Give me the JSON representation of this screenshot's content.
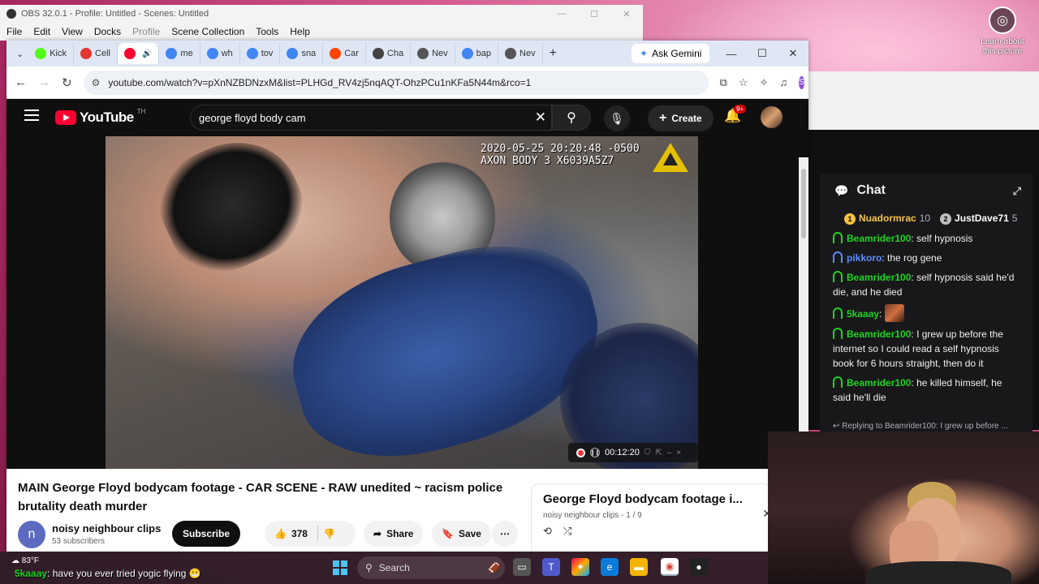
{
  "desktop": {
    "lens_label_line1": "Learn about",
    "lens_label_line2": "this picture"
  },
  "obs": {
    "title": "OBS 32.0.1 - Profile: Untitled - Scenes: Untitled",
    "menu": [
      "File",
      "Edit",
      "View",
      "Docks",
      "Profile",
      "Scene Collection",
      "Tools",
      "Help"
    ]
  },
  "chrome": {
    "tabs": [
      {
        "label": "Kick",
        "icon": "kick-icon",
        "color": "#53fc18"
      },
      {
        "label": "Cell",
        "icon": "cell-icon",
        "color": "#e5352f"
      },
      {
        "label": "",
        "icon": "youtube-icon",
        "color": "#ff0033"
      },
      {
        "label": "me",
        "icon": "google-icon",
        "color": "#4285f4"
      },
      {
        "label": "wh",
        "icon": "google-icon",
        "color": "#4285f4"
      },
      {
        "label": "tov",
        "icon": "google-icon",
        "color": "#4285f4"
      },
      {
        "label": "sna",
        "icon": "google-icon",
        "color": "#4285f4"
      },
      {
        "label": "Car",
        "icon": "reddit-icon",
        "color": "#ff4500"
      },
      {
        "label": "Cha",
        "icon": "chatgpt-icon",
        "color": "#444444"
      },
      {
        "label": "Nev",
        "icon": "chrome-icon",
        "color": "#555555"
      },
      {
        "label": "bap",
        "icon": "google-icon",
        "color": "#4285f4"
      },
      {
        "label": "Nev",
        "icon": "chrome-icon",
        "color": "#555555"
      }
    ],
    "ask_gemini": "Ask Gemini",
    "url": "youtube.com/watch?v=pXnNZBDNzxM&list=PLHGd_RV4zj5nqAQT-OhzPCu1nKFa5N44m&rco=1",
    "profile_initial": "S"
  },
  "youtube": {
    "logo": "YouTube",
    "country": "TH",
    "search_value": "george floyd body cam",
    "create_label": "Create",
    "notif_count": "9+",
    "video": {
      "stamp_line1": "2020-05-25 20:20:48 -0500",
      "stamp_line2": "AXON BODY 3 X6039A5Z7",
      "rec_time": "00:12:20"
    },
    "title": "MAIN George Floyd bodycam footage - CAR SCENE - RAW unedited ~ racism police brutality death murder",
    "channel": {
      "initial": "n",
      "name": "noisy neighbour clips",
      "subs": "53 subscribers",
      "subscribe": "Subscribe"
    },
    "likes": "378",
    "share": "Share",
    "save": "Save",
    "playlist": {
      "title": "George Floyd bodycam footage i...",
      "meta": "noisy neighbour clips - 1 / 9"
    }
  },
  "chat": {
    "title": "Chat",
    "leaders": [
      {
        "rank": "1",
        "name": "Nuadormrac",
        "points": "10",
        "color": "#f5c242",
        "name_color": "#f5c242"
      },
      {
        "rank": "2",
        "name": "JustDave71",
        "points": "5",
        "color": "#c0c0c0",
        "name_color": "#ffffff"
      }
    ],
    "messages": [
      {
        "user": "Beamrider100",
        "text": "self hypnosis",
        "color": "#1fd51f"
      },
      {
        "user": "pikkoro",
        "text": "the rog gene",
        "color": "#5b8cff"
      },
      {
        "user": "Beamrider100",
        "text": "self hypnosis said he'd die, and he died",
        "color": "#1fd51f"
      },
      {
        "user": "5kaaay",
        "text": "",
        "color": "#1fd51f",
        "emote": true
      },
      {
        "user": "Beamrider100",
        "text": "I grew up before the internet so I could read a self hypnosis book for 6 hours straight, then do it",
        "color": "#1fd51f"
      },
      {
        "user": "Beamrider100",
        "text": "he killed himself, he said he'll die",
        "color": "#1fd51f"
      }
    ],
    "reply": "Replying to Beamrider100: I grew up before ..."
  },
  "taskbar": {
    "temp": "83°F",
    "overlay_user": "5kaaay",
    "overlay_text": ": have you ever tried yogic flying",
    "search": "Search"
  }
}
